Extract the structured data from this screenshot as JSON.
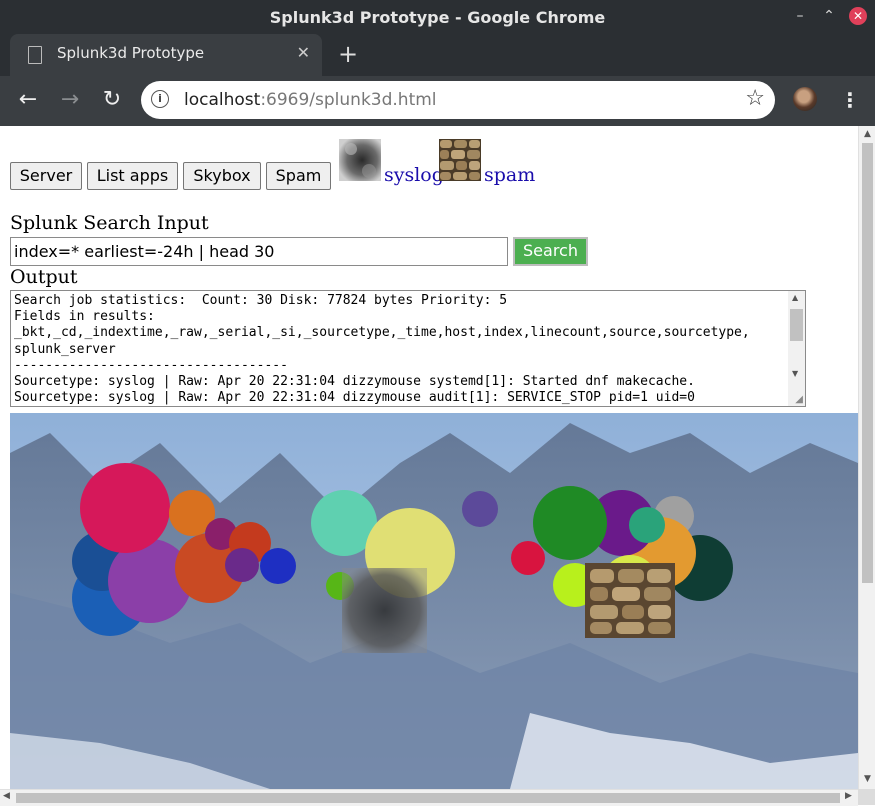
{
  "window": {
    "title": "Splunk3d Prototype - Google Chrome",
    "controls": [
      "–",
      "⌃",
      "✕"
    ]
  },
  "tab": {
    "title": "Splunk3d Prototype",
    "close": "✕",
    "new_tab": "+"
  },
  "toolbar": {
    "back": "←",
    "forward": "→",
    "reload": "↻",
    "url_host": "localhost",
    "url_rest": ":6969/splunk3d.html",
    "bookmark": "☆",
    "menu": "⋮"
  },
  "page": {
    "buttons": {
      "server": "Server",
      "list_apps": "List apps",
      "skybox": "Skybox",
      "spam": "Spam"
    },
    "links": {
      "syslog": "syslog",
      "spam": "spam"
    },
    "search_label": "Splunk Search Input",
    "search_value": "index=* earliest=-24h | head 30",
    "search_button": "Search",
    "output_label": "Output",
    "output_lines": [
      "Search job statistics:  Count: 30 Disk: 77824 bytes Priority: 5",
      "Fields in results:",
      "_bkt,_cd,_indextime,_raw,_serial,_si,_sourcetype,_time,host,index,linecount,source,sourcetype,",
      "splunk_server",
      "-----------------------------------",
      "Sourcetype: syslog | Raw: Apr 20 22:31:04 dizzymouse systemd[1]: Started dnf makecache.",
      "Sourcetype: syslog | Raw: Apr 20 22:31:04 dizzymouse audit[1]: SERVICE_STOP pid=1 uid=0"
    ]
  },
  "colors": {
    "search_button": "#4caf50",
    "link": "#1a0dab",
    "chrome_dark": "#2b2f33"
  }
}
